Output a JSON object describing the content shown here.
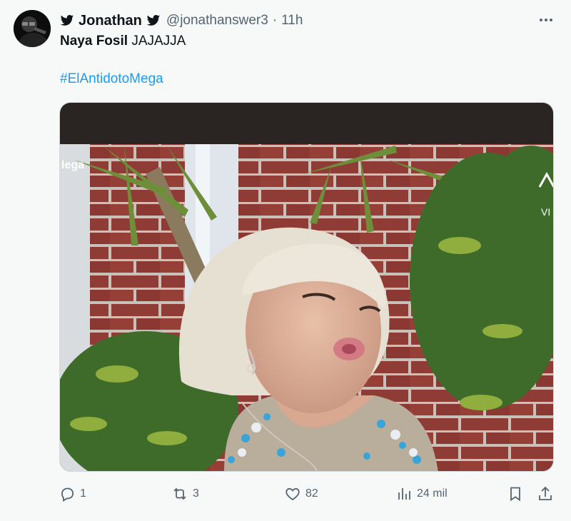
{
  "user": {
    "name": "Jonathan",
    "handle": "@jonathanswer3",
    "time": "11h",
    "separator": "·"
  },
  "tweet": {
    "bold_text": "Naya Fosil",
    "text": "JAJAJJA",
    "hashtag": "#ElAntidotoMega"
  },
  "media": {
    "watermark": "lega",
    "corner_text": "VI"
  },
  "actions": {
    "replies": "1",
    "retweets": "3",
    "likes": "82",
    "views": "24 mil"
  },
  "colors": {
    "link": "#1d9bf0",
    "muted": "#536471",
    "background": "#f7f9f9"
  }
}
